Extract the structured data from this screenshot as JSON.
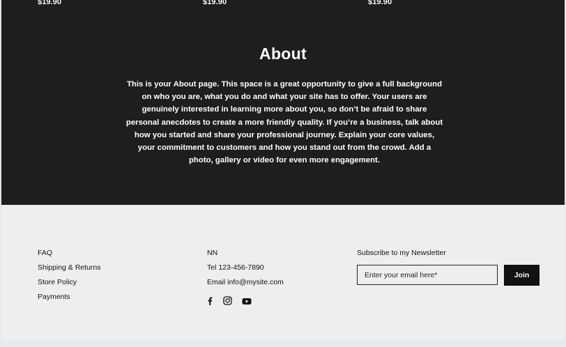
{
  "products": {
    "prices": [
      "$19.90",
      "$19.90",
      "$19.90"
    ]
  },
  "about": {
    "title": "About",
    "body": "This is your About page. This space is a great opportunity to give a full background on who you are, what you do and what your site has to offer. Your users are genuinely interested in learning more about you, so don’t be afraid to share personal anecdotes to create a more friendly quality. If you’re a business, talk about how you started and share your professional journey. Explain your core values, your commitment to customers and how you stand out from the crowd. Add a photo, gallery or video for even more engagement."
  },
  "footer": {
    "links": [
      "FAQ",
      "Shipping & Returns",
      "Store Policy",
      "Payments"
    ],
    "contact": {
      "name": "NN",
      "tel": "Tel 123-456-7890",
      "email": "Email info@mysite.com"
    },
    "social": [
      "facebook-icon",
      "instagram-icon",
      "youtube-icon"
    ],
    "newsletter": {
      "label": "Subscribe to my Newsletter",
      "placeholder": "Enter your email here*",
      "join_label": "Join"
    }
  },
  "colors": {
    "dark_bg": "#1e1e1e",
    "footer_bg": "#eeeeee",
    "accent": "#111111"
  }
}
